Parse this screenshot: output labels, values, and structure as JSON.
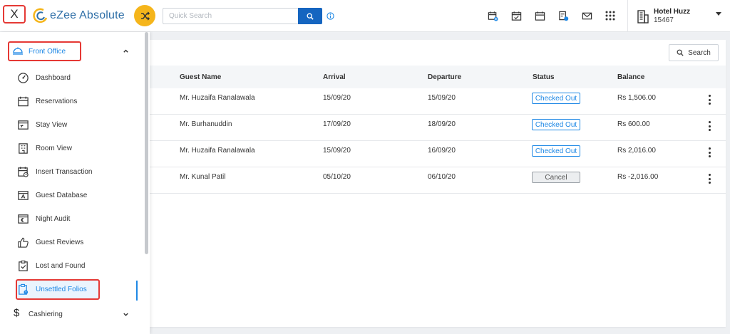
{
  "header": {
    "close_label": "X",
    "app_name": "eZee Absolute",
    "search_placeholder": "Quick Search",
    "icons": [
      "calendar-add-icon",
      "calendar-check-icon",
      "calendar-icon",
      "reservation-icon",
      "mail-icon",
      "apps-grid-icon"
    ],
    "hotel_name": "Hotel Huzz",
    "hotel_id": "15467"
  },
  "sidebar": {
    "group_label": "Front Office",
    "items": [
      {
        "label": "Dashboard",
        "icon": "dashboard-icon"
      },
      {
        "label": "Reservations",
        "icon": "calendar-icon"
      },
      {
        "label": "Stay View",
        "icon": "stay-view-icon"
      },
      {
        "label": "Room View",
        "icon": "room-view-icon"
      },
      {
        "label": "Insert Transaction",
        "icon": "transaction-icon"
      },
      {
        "label": "Guest Database",
        "icon": "guest-database-icon"
      },
      {
        "label": "Night Audit",
        "icon": "night-audit-icon"
      },
      {
        "label": "Guest Reviews",
        "icon": "thumbs-up-icon"
      },
      {
        "label": "Lost and Found",
        "icon": "lost-found-icon"
      },
      {
        "label": "Unsettled Folios",
        "icon": "folio-icon"
      }
    ],
    "active_item": "Unsettled Folios",
    "next_group_label": "Cashiering",
    "next_group_icon": "$"
  },
  "main": {
    "search_button": "Search",
    "columns": {
      "guest_name": "Guest Name",
      "arrival": "Arrival",
      "departure": "Departure",
      "status": "Status",
      "balance": "Balance"
    },
    "rows": [
      {
        "guest_name": "Mr. Huzaifa Ranalawala",
        "arrival": "15/09/20",
        "departure": "15/09/20",
        "status": "Checked Out",
        "balance": "Rs 1,506.00"
      },
      {
        "guest_name": "Mr. Burhanuddin",
        "arrival": "17/09/20",
        "departure": "18/09/20",
        "status": "Checked Out",
        "balance": "Rs 600.00"
      },
      {
        "guest_name": "Mr. Huzaifa Ranalawala",
        "arrival": "15/09/20",
        "departure": "16/09/20",
        "status": "Checked Out",
        "balance": "Rs 2,016.00"
      },
      {
        "guest_name": "Mr. Kunal Patil",
        "arrival": "05/10/20",
        "departure": "06/10/20",
        "status": "Cancel",
        "balance": "Rs -2,016.00"
      }
    ]
  },
  "colors": {
    "accent_blue": "#1e88e5",
    "primary_blue": "#1565c0",
    "shuffle_yellow": "#f5b51b",
    "highlight_red": "#e53935"
  }
}
